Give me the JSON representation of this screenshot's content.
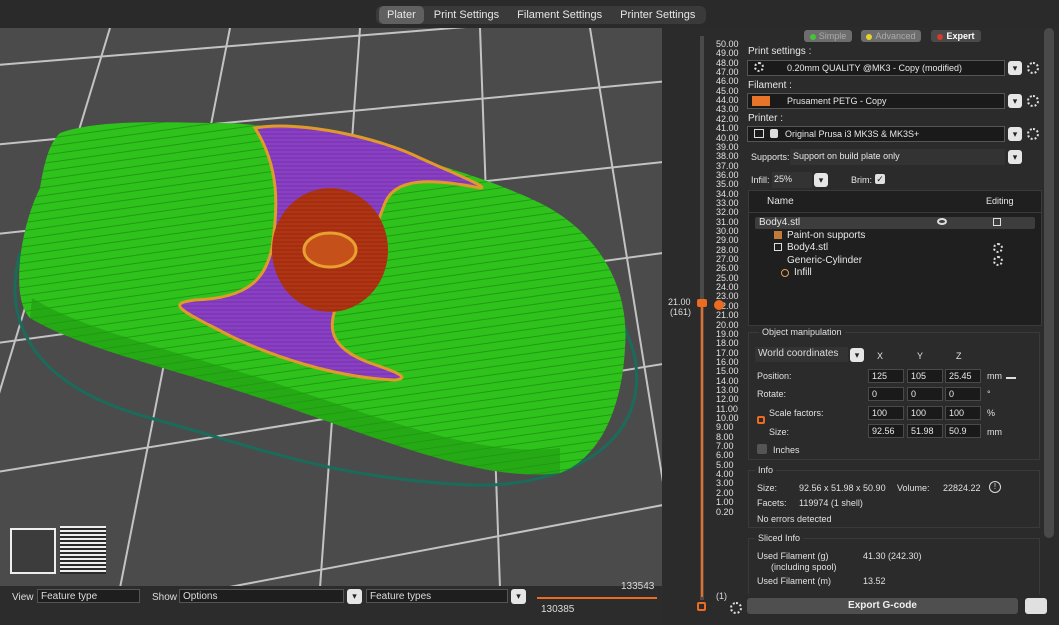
{
  "tabs": [
    "Plater",
    "Print Settings",
    "Filament Settings",
    "Printer Settings"
  ],
  "bottom": {
    "view_label": "View",
    "view_value": "Feature type",
    "show_label": "Show",
    "show_value": "Options",
    "feature_types": "Feature types",
    "move_top": "133543",
    "move_bottom": "130385"
  },
  "layer_slider": {
    "ticks": [
      "50.00",
      "49.00",
      "48.00",
      "47.00",
      "46.00",
      "45.00",
      "44.00",
      "43.00",
      "42.00",
      "41.00",
      "40.00",
      "39.00",
      "38.00",
      "37.00",
      "36.00",
      "35.00",
      "34.00",
      "33.00",
      "32.00",
      "31.00",
      "30.00",
      "29.00",
      "28.00",
      "27.00",
      "26.00",
      "25.00",
      "24.00",
      "23.00",
      "22.00",
      "21.00",
      "20.00",
      "19.00",
      "18.00",
      "17.00",
      "16.00",
      "15.00",
      "14.00",
      "13.00",
      "12.00",
      "11.00",
      "10.00",
      "9.00",
      "8.00",
      "7.00",
      "6.00",
      "5.00",
      "4.00",
      "3.00",
      "2.00",
      "1.00",
      "0.20"
    ],
    "current_height": "21.00",
    "current_layer": "(161)",
    "bottom_layer": "(1)"
  },
  "modes": {
    "simple": "Simple",
    "advanced": "Advanced",
    "expert": "Expert"
  },
  "colors": {
    "simple": "#49c23b",
    "advanced": "#e6d32a",
    "expert": "#d63a2a",
    "accent": "#ed6b21",
    "filament": "#e8742a"
  },
  "print_settings": {
    "label": "Print settings :",
    "value": "0.20mm QUALITY @MK3 - Copy (modified)"
  },
  "filament": {
    "label": "Filament :",
    "value": "Prusament PETG - Copy"
  },
  "printer": {
    "label": "Printer :",
    "value": "Original Prusa i3 MK3S & MK3S+"
  },
  "supports": {
    "label": "Supports:",
    "value": "Support on build plate only"
  },
  "infill": {
    "label": "Infill:",
    "value": "25%"
  },
  "brim": {
    "label": "Brim:"
  },
  "object_list": {
    "col_name": "Name",
    "col_editing": "Editing",
    "rows": [
      "Body4.stl",
      "Paint-on supports",
      "Body4.stl",
      "Generic-Cylinder",
      "Infill"
    ]
  },
  "manipulation": {
    "title": "Object manipulation",
    "coords": "World coordinates",
    "x": "X",
    "y": "Y",
    "z": "Z",
    "position_label": "Position:",
    "position": [
      "125",
      "105",
      "25.45"
    ],
    "position_unit": "mm",
    "rotate_label": "Rotate:",
    "rotate": [
      "0",
      "0",
      "0"
    ],
    "rotate_unit": "°",
    "scale_label": "Scale factors:",
    "scale": [
      "100",
      "100",
      "100"
    ],
    "scale_unit": "%",
    "size_label": "Size:",
    "size": [
      "92.56",
      "51.98",
      "50.9"
    ],
    "size_unit": "mm",
    "inches": "Inches"
  },
  "info": {
    "title": "Info",
    "size_label": "Size:",
    "size_value": "92.56 x 51.98 x 50.90",
    "volume_label": "Volume:",
    "volume_value": "22824.22",
    "facets_label": "Facets:",
    "facets_value": "119974 (1 shell)",
    "errors": "No errors detected"
  },
  "sliced": {
    "title": "Sliced Info",
    "used_g_label": "Used Filament (g)",
    "used_g_sub": "(including spool)",
    "used_g_value": "41.30 (242.30)",
    "used_m_label": "Used Filament (m)",
    "used_m_value": "13.52"
  },
  "export": "Export G-code"
}
